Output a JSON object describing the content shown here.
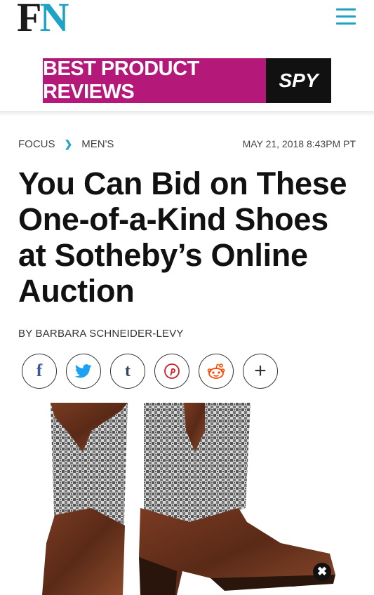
{
  "header": {
    "logo_f": "F",
    "logo_n": "N",
    "menu_icon": "hamburger-menu-icon"
  },
  "ad": {
    "left_text": "BEST PRODUCT REVIEWS",
    "right_text": "SPY"
  },
  "breadcrumb": {
    "items": [
      "FOCUS",
      "MEN'S"
    ],
    "separator": "❯"
  },
  "article": {
    "date": "MAY 21, 2018 8:43PM PT",
    "title": "You Can Bid on These One-of-a-Kind Shoes at Sotheby’s Online Auction",
    "byline": "BY BARBARA SCHNEIDER-LEVY"
  },
  "share": {
    "icons": [
      "facebook-icon",
      "twitter-icon",
      "tumblr-icon",
      "pinterest-icon",
      "reddit-icon",
      "plus-icon"
    ],
    "labels": [
      "f",
      "t",
      "+"
    ]
  },
  "colors": {
    "accent": "#1fa3c4",
    "ad_magenta": "#b4197a",
    "ad_black": "#111111"
  },
  "overlay": {
    "close_glyph": "✖"
  }
}
